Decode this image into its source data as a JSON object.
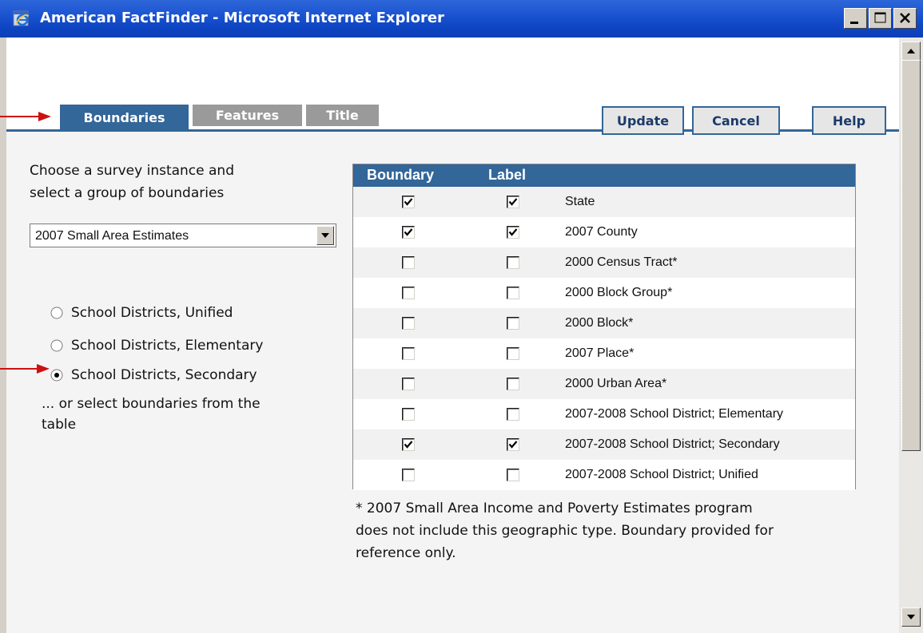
{
  "window": {
    "title": "American FactFinder - Microsoft Internet Explorer",
    "controls": [
      "minimize",
      "maximize",
      "close"
    ]
  },
  "toolbar": {
    "update_label": "Update",
    "cancel_label": "Cancel",
    "help_label": "Help"
  },
  "tabs": [
    {
      "label": "Boundaries",
      "active": true
    },
    {
      "label": "Features",
      "active": false
    },
    {
      "label": "Title",
      "active": false
    }
  ],
  "left": {
    "prompt_line1": "Choose a survey instance and",
    "prompt_line2": "select a group of boundaries",
    "survey_select": "2007 Small Area Estimates",
    "radios": [
      {
        "label": "School Districts, Unified",
        "checked": false
      },
      {
        "label": "School Districts, Elementary",
        "checked": false
      },
      {
        "label": "School Districts, Secondary",
        "checked": true
      }
    ],
    "or_select_line1": "... or select boundaries from the",
    "or_select_line2": "table"
  },
  "table": {
    "headers": [
      "Boundary",
      "Label"
    ],
    "rows": [
      {
        "name": "State",
        "boundary": true,
        "label": true
      },
      {
        "name": "2007 County",
        "boundary": true,
        "label": true
      },
      {
        "name": "2000 Census Tract*",
        "boundary": false,
        "label": false
      },
      {
        "name": "2000 Block Group*",
        "boundary": false,
        "label": false
      },
      {
        "name": "2000 Block*",
        "boundary": false,
        "label": false
      },
      {
        "name": "2007 Place*",
        "boundary": false,
        "label": false
      },
      {
        "name": "2000 Urban Area*",
        "boundary": false,
        "label": false
      },
      {
        "name": "2007-2008 School District; Elementary",
        "boundary": false,
        "label": false
      },
      {
        "name": "2007-2008 School District; Secondary",
        "boundary": true,
        "label": true
      },
      {
        "name": "2007-2008 School District; Unified",
        "boundary": false,
        "label": false
      }
    ]
  },
  "footnote": {
    "line1": "* 2007 Small Area Income and Poverty Estimates program",
    "line2": "does not include this geographic type. Boundary provided for",
    "line3": "reference only."
  },
  "colors": {
    "accent": "#336699",
    "titlebar": "#0e46c4",
    "annotation_arrow": "#cc1111"
  },
  "icons": {
    "app": "internet-explorer-icon",
    "annotation": "red-arrow-icon"
  }
}
